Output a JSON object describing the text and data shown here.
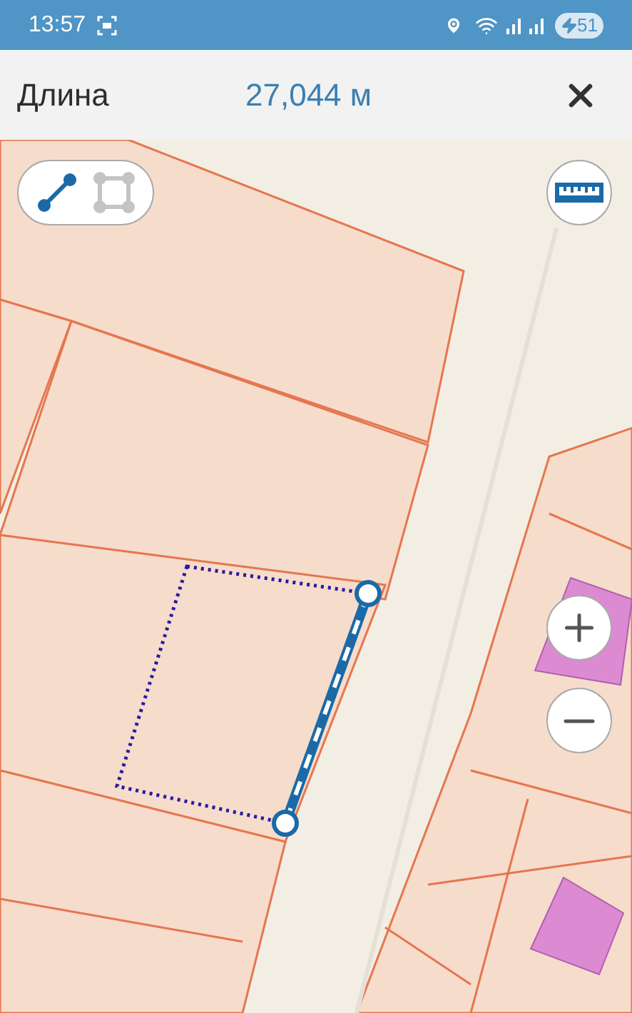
{
  "status_bar": {
    "time": "13:57",
    "battery": "51"
  },
  "header": {
    "title": "Длина",
    "value": "27,044 м"
  },
  "mode_toggle": [
    {
      "kind": "line",
      "selected": true
    },
    {
      "kind": "polygon",
      "selected": false
    }
  ]
}
